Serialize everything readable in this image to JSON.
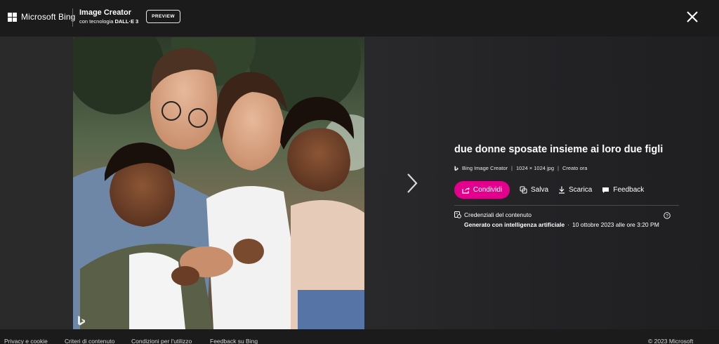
{
  "header": {
    "brand": "Microsoft Bing",
    "product_title": "Image Creator",
    "product_subtitle_prefix": "con tecnologia ",
    "product_subtitle_bold": "DALL·E 3",
    "preview_badge": "PREVIEW",
    "close_icon": "close-icon"
  },
  "image": {
    "alt": "due donne sposate insieme ai loro due figli",
    "watermark": "b"
  },
  "details": {
    "title": "due donne sposate insieme ai loro due figli",
    "source": "Bing Image Creator",
    "dimensions": "1024 × 1024 jpg",
    "created": "Creato ora",
    "actions": {
      "share": "Condividi",
      "save": "Salva",
      "download": "Scarica",
      "feedback": "Feedback"
    },
    "credentials": {
      "heading": "Credenziali del contenuto",
      "generated_bold": "Generato con intelligenza artificiale",
      "date": "10 ottobre 2023 alle ore 3:20 PM"
    }
  },
  "footer": {
    "links": [
      "Privacy e cookie",
      "Criteri di contenuto",
      "Condizioni per l'utilizzo",
      "Feedback su Bing"
    ],
    "copyright": "© 2023 Microsoft"
  },
  "colors": {
    "accent": "#e3008c",
    "background": "#1b1b1b"
  }
}
